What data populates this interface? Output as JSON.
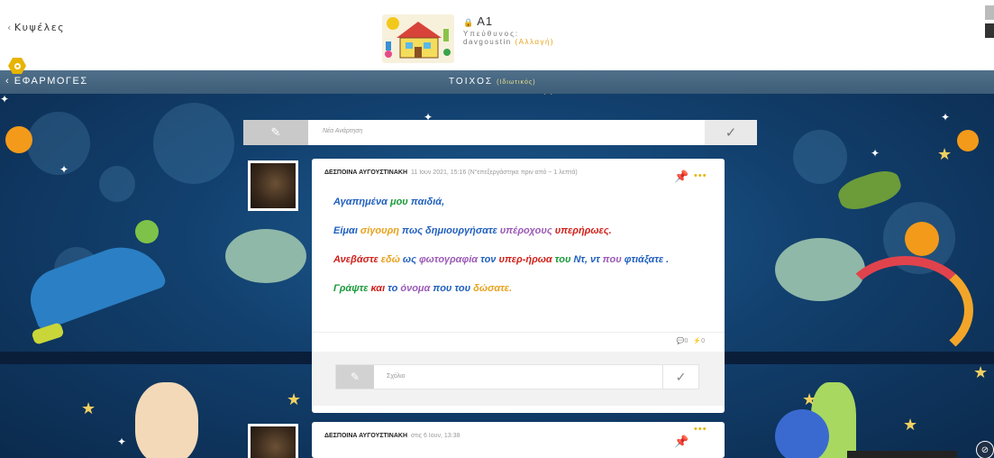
{
  "header": {
    "back_label": "Κυψέλες",
    "class_name": "A1",
    "owner_label": "Υπεύθυνος:",
    "owner_name": "davgoustin",
    "change_label": "(Αλλαγή)"
  },
  "apps_bar": {
    "apps_label": "ΕΦΑΡΜΟΓΕΣ",
    "wall_title": "ΤΟΙΧΟΣ",
    "wall_privacy": "(Ιδιωτικός)"
  },
  "new_post": {
    "placeholder": "Νέα Ανάρτηση"
  },
  "posts": [
    {
      "author": "ΔΕΣΠΟΙΝΑ ΑΥΓΟΥΣΤΙΝΑΚΗ",
      "meta": "11 Ιουν 2021, 15:16 (Ν°επεξεργάστηκε πριν από ~ 1 λεπτά)",
      "lines": [
        [
          {
            "t": "Αγαπημένα",
            "c": "#1f5fbf"
          },
          {
            "t": "μου",
            "c": "#1a9a3a"
          },
          {
            "t": "παιδιά,",
            "c": "#1f5fbf"
          }
        ],
        [
          {
            "t": "Είμαι",
            "c": "#1f5fbf"
          },
          {
            "t": "σίγουρη",
            "c": "#e8a11b"
          },
          {
            "t": "πως",
            "c": "#1f5fbf"
          },
          {
            "t": "δημιουργήσατε",
            "c": "#1f5fbf"
          },
          {
            "t": "υπέροχους",
            "c": "#9b59b6"
          },
          {
            "t": "υπερήρωες.",
            "c": "#d0201a"
          }
        ],
        [
          {
            "t": "Ανεβάστε",
            "c": "#d0201a"
          },
          {
            "t": "εδώ",
            "c": "#e8a11b"
          },
          {
            "t": "ως",
            "c": "#1f5fbf"
          },
          {
            "t": "φωτογραφία",
            "c": "#9b59b6"
          },
          {
            "t": "τον",
            "c": "#1f5fbf"
          },
          {
            "t": "υπερ-ήρωα",
            "c": "#d0201a"
          },
          {
            "t": "του",
            "c": "#1a9a3a"
          },
          {
            "t": "Ντ, ντ",
            "c": "#1f5fbf"
          },
          {
            "t": "που",
            "c": "#9b59b6"
          },
          {
            "t": "φτιάξατε .",
            "c": "#1f5fbf"
          }
        ],
        [
          {
            "t": "Γράψτε",
            "c": "#1a9a3a"
          },
          {
            "t": "και",
            "c": "#d0201a"
          },
          {
            "t": "το",
            "c": "#1f5fbf"
          },
          {
            "t": "όνομα",
            "c": "#9b59b6"
          },
          {
            "t": "που",
            "c": "#1f5fbf"
          },
          {
            "t": "του",
            "c": "#1f5fbf"
          },
          {
            "t": "δώσατε.",
            "c": "#e8a11b"
          }
        ]
      ],
      "comments_count": "0",
      "likes_count": "0",
      "comment_placeholder": "Σχόλιο"
    },
    {
      "author": "ΔΕΣΠΟΙΝΑ ΑΥΓΟΥΣΤΙΝΑΚΗ",
      "meta": "στις 6 Ιουν, 13:38"
    }
  ],
  "icons": {
    "edit": "pencil-square-icon",
    "check": "check-icon",
    "pin": "pin-icon",
    "more": "more-dots-icon",
    "comment": "comment-bubble-icon",
    "like": "lightning-icon"
  },
  "colors": {
    "accent": "#e8b400",
    "apps_bar": "#446480",
    "background": "#12406e"
  }
}
